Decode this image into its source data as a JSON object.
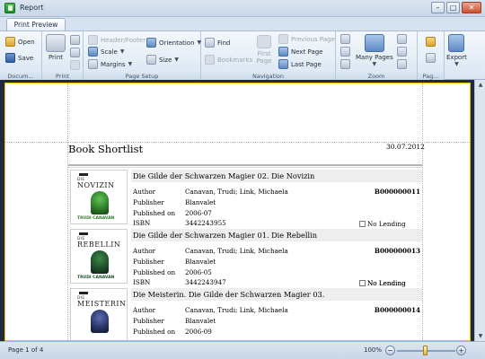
{
  "window": {
    "title": "Report"
  },
  "tabs": [
    {
      "label": "Print Preview",
      "active": true
    }
  ],
  "ribbon": {
    "document": {
      "label": "Docum...",
      "open": "Open",
      "save": "Save"
    },
    "print": {
      "label": "Print",
      "print": "Print"
    },
    "page_setup": {
      "label": "Page Setup",
      "header_footer": "Header/Footer",
      "scale": "Scale",
      "margins": "Margins",
      "orientation": "Orientation",
      "size": "Size"
    },
    "navigation": {
      "label": "Navigation",
      "find": "Find",
      "bookmarks": "Bookmarks",
      "first_page": "First Page",
      "previous_page": "Previous Page",
      "next_page": "Next Page",
      "last_page": "Last Page"
    },
    "zoom": {
      "label": "Zoom",
      "many_pages": "Many Pages"
    },
    "page_bg": {
      "label": "Pag..."
    },
    "export": {
      "label": "Export"
    }
  },
  "report": {
    "title": "Book Shortlist",
    "date": "30.07.2012",
    "field_labels": {
      "author": "Author",
      "publisher": "Publisher",
      "published_on": "Published on",
      "isbn": "ISBN"
    },
    "no_lending_label": "No Lending",
    "books": [
      {
        "title": "Die Gilde der Schwarzen Magier 02. Die Novizin",
        "author": "Canavan, Trudi; Link, Michaela",
        "publisher": "Blanvalet",
        "published_on": "2006-07",
        "isbn": "3442243955",
        "code": "B000000011",
        "cover": {
          "series": "DIE",
          "title": "NOVIZIN",
          "author": "TRUDI CANAVAN",
          "figure_color": "#2f7d2b"
        }
      },
      {
        "title": "Die Gilde der Schwarzen Magier 01. Die Rebellin",
        "author": "Canavan, Trudi; Link, Michaela",
        "publisher": "Blanvalet",
        "published_on": "2006-05",
        "isbn": "3442243947",
        "code": "B000000013",
        "cover": {
          "series": "DIE",
          "title": "REBELLIN",
          "author": "TRUDI CANAVAN",
          "figure_color": "#1f4f2a"
        }
      },
      {
        "title": "Die Meisterin. Die Gilde der Schwarzen Magier 03.",
        "author": "Canavan, Trudi; Link, Michaela",
        "publisher": "Blanvalet",
        "published_on": "2006-09",
        "code": "B000000014",
        "cover": {
          "series": "DIE",
          "title": "MEISTERIN",
          "author": "",
          "figure_color": "#2a3566"
        }
      }
    ]
  },
  "status": {
    "page": "Page 1 of 4",
    "zoom": "100%",
    "zoom_minus": "−",
    "zoom_plus": "+"
  }
}
